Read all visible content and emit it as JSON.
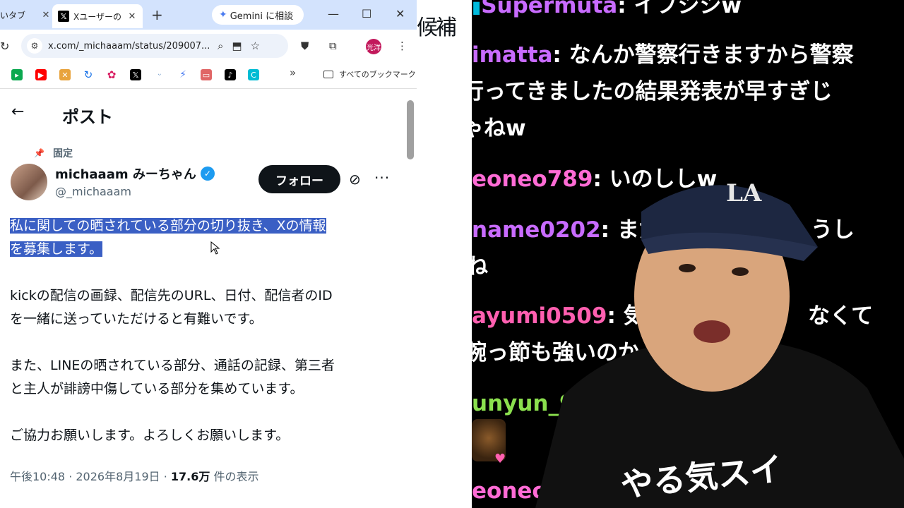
{
  "browser": {
    "tabs": [
      {
        "label": "いタブ",
        "active": false
      },
      {
        "label": "Xユーザーの",
        "active": true
      }
    ],
    "gemini_button": "Gemini に相談",
    "url": "x.com/_michaaam/status/209007...",
    "profile_initial": "光洋",
    "bookmarks_all": "すべてのブックマーク",
    "bookmark_colors": [
      "#0aa84f",
      "#ff0000",
      "#e8a33d",
      "#1a73e8",
      "#d81b60",
      "#000000",
      "#4f81bd",
      "#4a7bf0",
      "#e06666",
      "#000000",
      "#00bcd4"
    ]
  },
  "post": {
    "header_title": "ポスト",
    "pinned_label": "固定",
    "display_name": "michaaam みーちゃん",
    "handle": "@_michaaam",
    "follow_label": "フォロー",
    "highlighted_line1": "私に関しての晒されている部分の切り抜き、Xの情報",
    "highlighted_line2": "を募集します。",
    "para2_line1": "kickの配信の画録、配信先のURL、日付、配信者のID",
    "para2_line2": "を一緒に送っていただけると有難いです。",
    "para3_line1": "また、LINEの晒されている部分、通話の記録、第三者",
    "para3_line2": "と主人が誹謗中傷している部分を集めています。",
    "para4": "ご協力お願いします。よろしくお願いします。",
    "meta_time": "午後10:48 · 2026年8月19日 · ",
    "meta_views": "17.6万",
    "meta_views_suffix": " 件の表示"
  },
  "gap_text": "候補",
  "chat": {
    "messages": [
      {
        "user": "Supermuta",
        "user_color": "#c86bff",
        "text": "イフシシw"
      },
      {
        "user": "imatta",
        "user_color": "#c86bff",
        "text": "なんか警察行きますから警察"
      },
      {
        "user": "",
        "user_color": "#ffffff",
        "text": "行ってきましたの結果発表が早すぎじ"
      },
      {
        "user": "",
        "user_color": "#ffffff",
        "text": "ゃねw"
      },
      {
        "user": "eoneo789",
        "user_color": "#ff6bd5",
        "text": "いのししw"
      },
      {
        "user": "name0202",
        "user_color": "#c86bff",
        "text": "まだ"
      },
      {
        "user": "",
        "user_color": "#ffffff",
        "text": "ね"
      },
      {
        "user": "ayumi0509",
        "user_color": "#ff5fb0",
        "text": "気が"
      },
      {
        "user": "",
        "user_color": "#ffffff",
        "text": "腕っ節も強いのか"
      },
      {
        "user": "unyun_9",
        "user_color": "#8be04e",
        "text": ""
      },
      {
        "user": "eoneo",
        "user_color": "#ff6bd5",
        "text": ""
      }
    ],
    "right_fragments": [
      "うし",
      "なくて"
    ],
    "shirt_text": "やる気スイ"
  }
}
